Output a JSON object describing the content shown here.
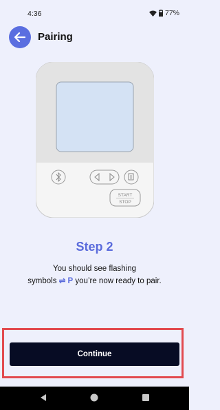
{
  "status_bar": {
    "time": "4:36",
    "battery": "77%"
  },
  "header": {
    "title": "Pairing",
    "back_icon": "arrow-left-icon"
  },
  "device": {
    "start_label": "START",
    "stop_label": "STOP"
  },
  "step": {
    "title": "Step 2",
    "line1": "You should see flashing",
    "line2_pre": "symbols",
    "line2_symbols": "⇌ P",
    "line2_post": "you’re now ready to pair."
  },
  "footer": {
    "continue_label": "Continue"
  },
  "colors": {
    "background": "#eef0fc",
    "accent": "#5a6bdc",
    "button": "#070c24",
    "highlight": "#e24a4f"
  }
}
